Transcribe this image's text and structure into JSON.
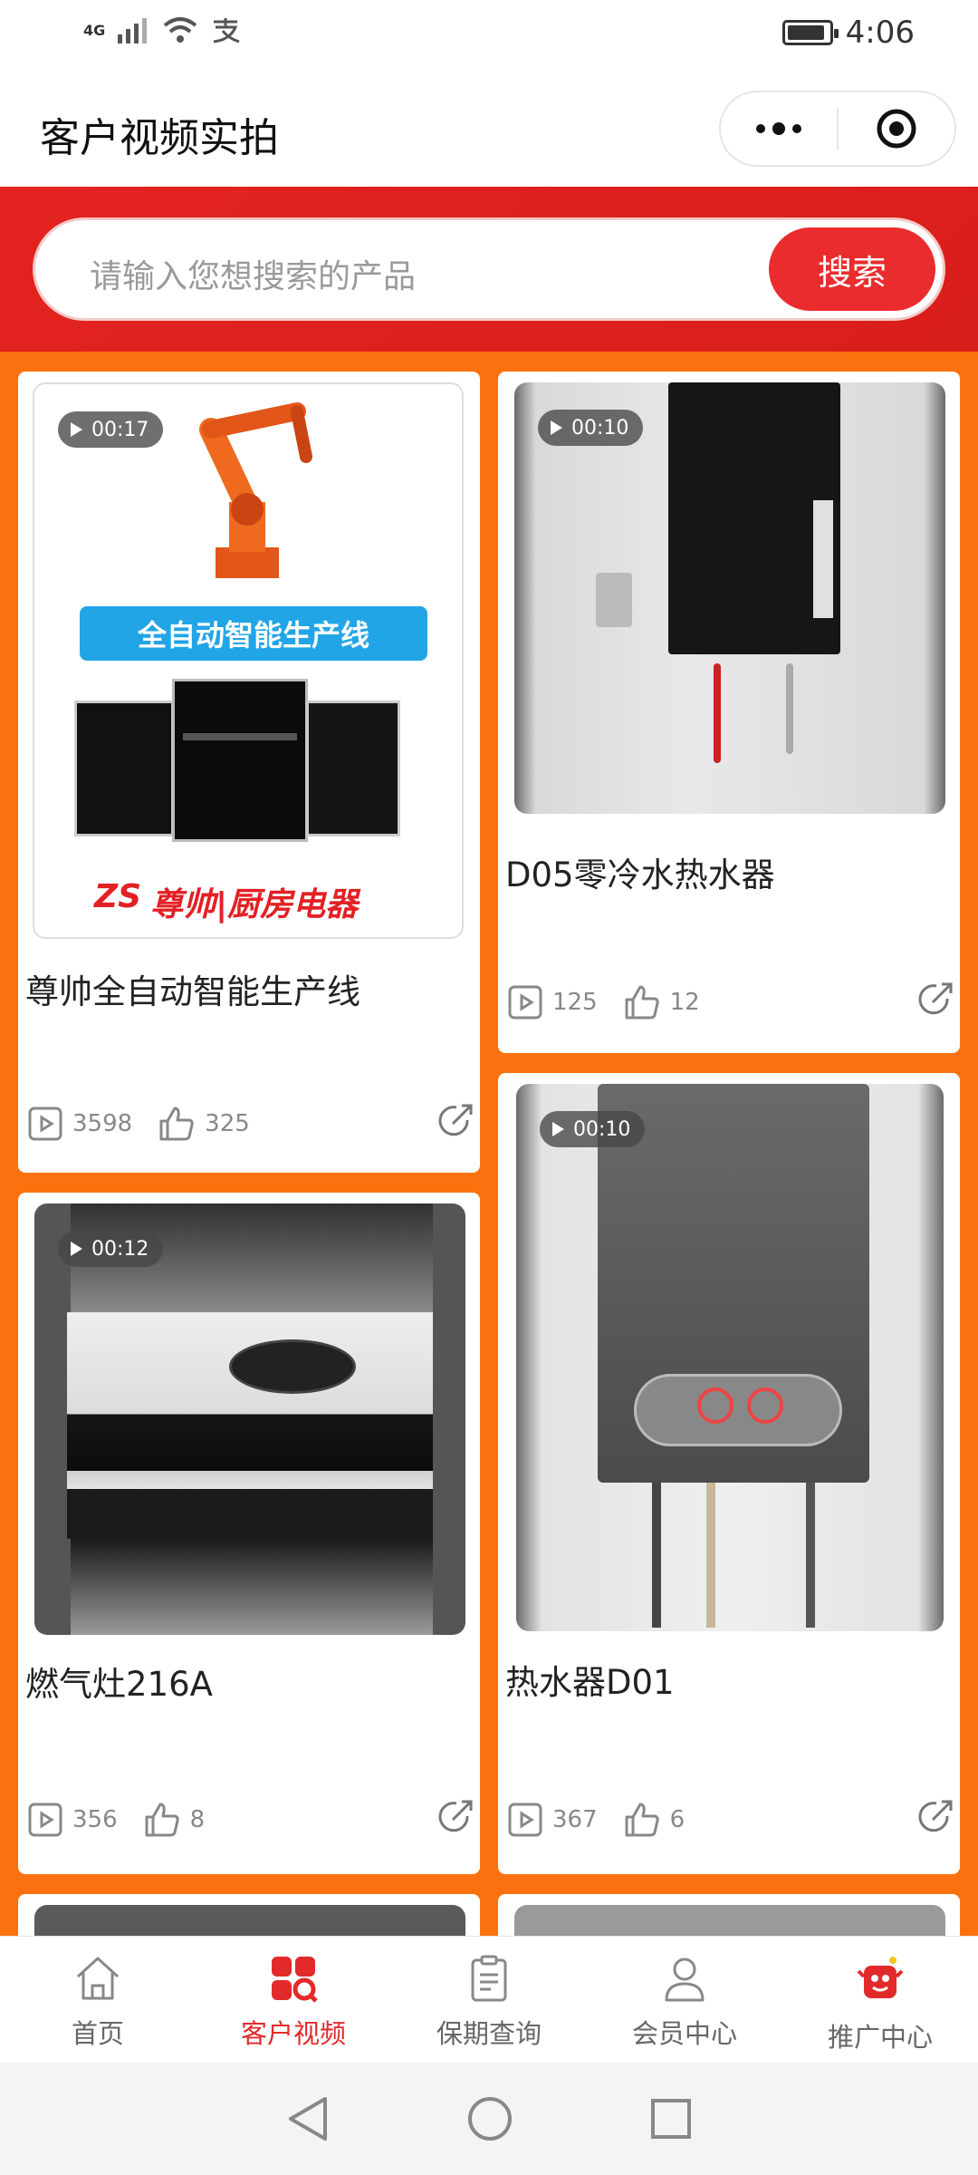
{
  "status_bar": {
    "network": "4G",
    "time": "4:06"
  },
  "header": {
    "title": "客户视频实拍"
  },
  "search": {
    "placeholder": "请输入您想搜索的产品",
    "button": "搜索"
  },
  "videos": [
    {
      "duration": "00:17",
      "title": "尊帅全自动智能生产线",
      "views": "3598",
      "likes": "325",
      "thumb_banner": "全自动智能生产线",
      "thumb_brand": "尊帅|厨房电器",
      "thumb_logo": "ZS"
    },
    {
      "duration": "00:10",
      "title": "D05零冷水热水器",
      "views": "125",
      "likes": "12"
    },
    {
      "duration": "00:12",
      "title": "燃气灶216A",
      "views": "356",
      "likes": "8"
    },
    {
      "duration": "00:10",
      "title": "热水器D01",
      "views": "367",
      "likes": "6"
    }
  ],
  "tabbar": [
    {
      "label": "首页",
      "icon": "home-icon"
    },
    {
      "label": "客户视频",
      "icon": "grid-video-icon",
      "active": true
    },
    {
      "label": "保期查询",
      "icon": "clipboard-icon"
    },
    {
      "label": "会员中心",
      "icon": "user-icon"
    },
    {
      "label": "推广中心",
      "icon": "mascot-icon"
    }
  ],
  "colors": {
    "brand_red": "#e32a2b",
    "orange_bg": "#fb7110",
    "search_button": "#ea2c2e"
  }
}
